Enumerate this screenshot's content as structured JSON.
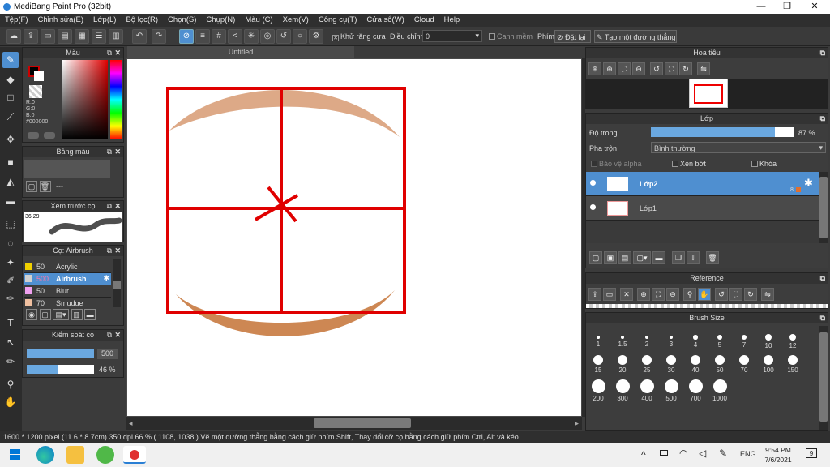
{
  "window": {
    "title": "MediBang Paint Pro (32bit)"
  },
  "menu": [
    "Tệp(F)",
    "Chỉnh sửa(E)",
    "Lớp(L)",
    "Bộ lọc(R)",
    "Chọn(S)",
    "Chụp(N)",
    "Màu (C)",
    "Xem(V)",
    "Công cụ(T)",
    "Cửa sổ(W)",
    "Cloud",
    "Help"
  ],
  "toolbar": {
    "antialias": "Khử răng cưa",
    "correction_label": "Điều chỉnh",
    "correction_value": "0",
    "edge": "Canh mềm",
    "phim": "Phím",
    "reset": "Đặt lại",
    "create_line": "Tạo một đường thẳng"
  },
  "color_panel": {
    "title": "Màu",
    "r": "R:0",
    "g": "G:0",
    "b": "B:0",
    "hex": "#000000"
  },
  "palette_panel": {
    "title": "Bảng màu",
    "dash": "---"
  },
  "brush_preview": {
    "title": "Xem trước cọ",
    "size": "36.29"
  },
  "brush_panel": {
    "title": "Cọ: Airbrush",
    "items": [
      {
        "size": "50",
        "name": "Acrylic",
        "color": "#f0d000"
      },
      {
        "size": "500",
        "name": "Airbrush",
        "color": "#d0d0d0"
      },
      {
        "size": "50",
        "name": "Blur",
        "color": "#f0a0f0"
      },
      {
        "size": "70",
        "name": "Smudge",
        "color": "#f0c0a0"
      }
    ]
  },
  "control_panel": {
    "title": "Kiểm soát cọ",
    "size": "500",
    "opacity": "46 %",
    "opacity_fraction": 0.46
  },
  "canvas": {
    "tab": "Untitled"
  },
  "navigator": {
    "title": "Hoa tiêu"
  },
  "layer_panel": {
    "title": "Lớp",
    "opacity_label": "Độ trong",
    "opacity_value": "87 %",
    "opacity_fraction": 0.87,
    "blend_label": "Pha trộn",
    "blend_value": "Bình thường",
    "protect_alpha": "Bảo vệ alpha",
    "clipping": "Xén bớt",
    "lock": "Khóa",
    "layers": [
      {
        "name": "Lớp2",
        "badge": "8"
      },
      {
        "name": "Lớp1"
      }
    ]
  },
  "reference_panel": {
    "title": "Reference"
  },
  "brush_size_panel": {
    "title": "Brush Size",
    "sizes": [
      "1",
      "1.5",
      "2",
      "3",
      "4",
      "5",
      "7",
      "10",
      "12",
      "15",
      "20",
      "25",
      "30",
      "40",
      "50",
      "70",
      "100",
      "150",
      "200",
      "300",
      "400",
      "500",
      "700",
      "1000"
    ]
  },
  "status": "1600 * 1200 pixel   (11.6 * 8.7cm)   350 dpi   66 %   ( 1108, 1038 )   Vẽ một đường thẳng bằng cách giữ phím Shift, Thay đổi cỡ cọ bằng cách giữ phím Ctrl, Alt và kéo",
  "taskbar": {
    "lang": "ENG",
    "time": "9:54 PM",
    "date": "7/6/2021",
    "notif": "9"
  }
}
